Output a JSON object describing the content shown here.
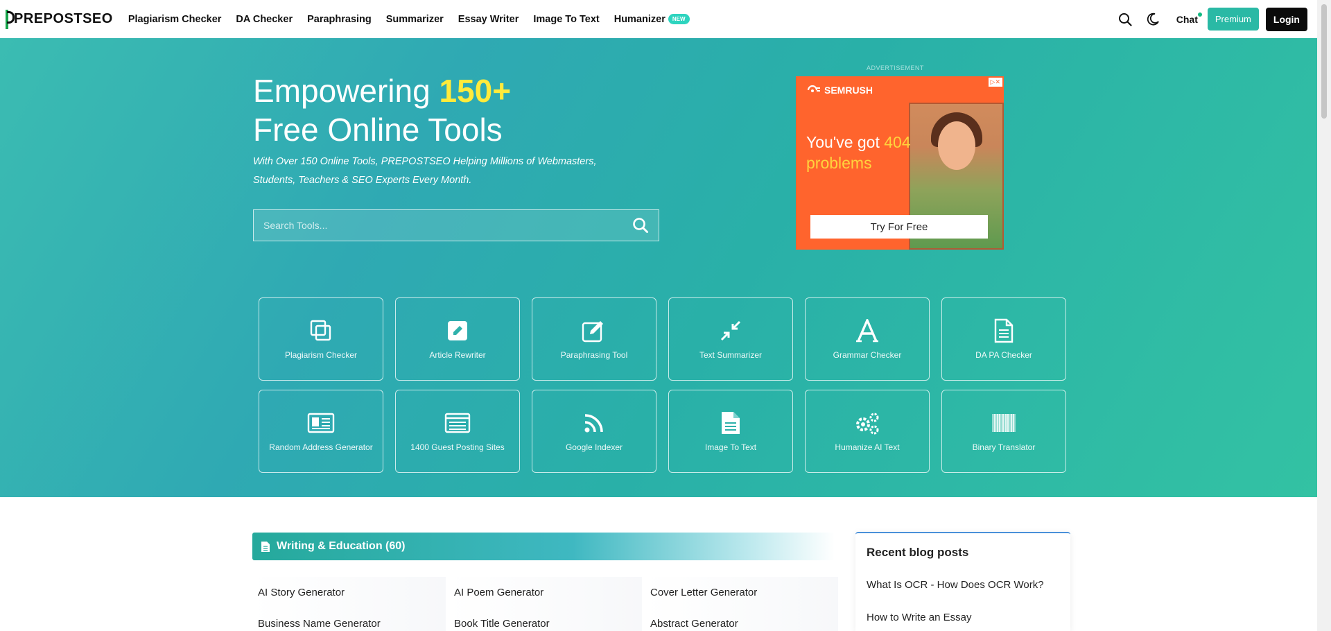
{
  "header": {
    "logo": "PREPOSTSEO",
    "nav": [
      {
        "label": "Plagiarism Checker"
      },
      {
        "label": "DA Checker"
      },
      {
        "label": "Paraphrasing"
      },
      {
        "label": "Summarizer"
      },
      {
        "label": "Essay Writer"
      },
      {
        "label": "Image To Text"
      },
      {
        "label": "Humanizer",
        "badge": "NEW"
      }
    ],
    "chat": "Chat",
    "premium": "Premium",
    "login": "Login"
  },
  "hero": {
    "title_pre": "Empowering ",
    "title_highlight": "150+",
    "title_line2": "Free Online Tools",
    "subtitle": "With Over 150 Online Tools, PREPOSTSEO Helping Millions of Webmasters, Students, Teachers & SEO Experts Every Month.",
    "search_placeholder": "Search Tools..."
  },
  "ad": {
    "label": "ADVERTISEMENT",
    "brand": "SEMRUSH",
    "headline_pre": "You've got ",
    "headline_num": "404",
    "headline_post": "problems",
    "cta": "Try For Free"
  },
  "tools": [
    {
      "label": "Plagiarism Checker",
      "icon": "copy-icon"
    },
    {
      "label": "Article Rewriter",
      "icon": "edit-square-icon"
    },
    {
      "label": "Paraphrasing Tool",
      "icon": "pen-square-icon"
    },
    {
      "label": "Text Summarizer",
      "icon": "compress-icon"
    },
    {
      "label": "Grammar Checker",
      "icon": "letter-a-icon"
    },
    {
      "label": "DA PA Checker",
      "icon": "document-icon"
    },
    {
      "label": "Random Address Generator",
      "icon": "id-card-icon"
    },
    {
      "label": "1400 Guest Posting Sites",
      "icon": "list-window-icon"
    },
    {
      "label": "Google Indexer",
      "icon": "rss-icon"
    },
    {
      "label": "Image To Text",
      "icon": "file-text-icon"
    },
    {
      "label": "Humanize AI Text",
      "icon": "gears-icon"
    },
    {
      "label": "Binary Translator",
      "icon": "barcode-icon"
    }
  ],
  "section": {
    "title": "Writing & Education (60)",
    "items": [
      "AI Story Generator",
      "AI Poem Generator",
      "Cover Letter Generator",
      "Business Name Generator",
      "Book Title Generator",
      "Abstract Generator"
    ]
  },
  "blog": {
    "title": "Recent blog posts",
    "posts": [
      "What Is OCR - How Does OCR Work?",
      "How to Write an Essay"
    ]
  },
  "colors": {
    "accent": "#2ab9a5",
    "hero_start": "#3bbcb2",
    "hero_end": "#33c2a3",
    "ad_orange": "#ff642d",
    "highlight_yellow": "#ffeb3b"
  }
}
